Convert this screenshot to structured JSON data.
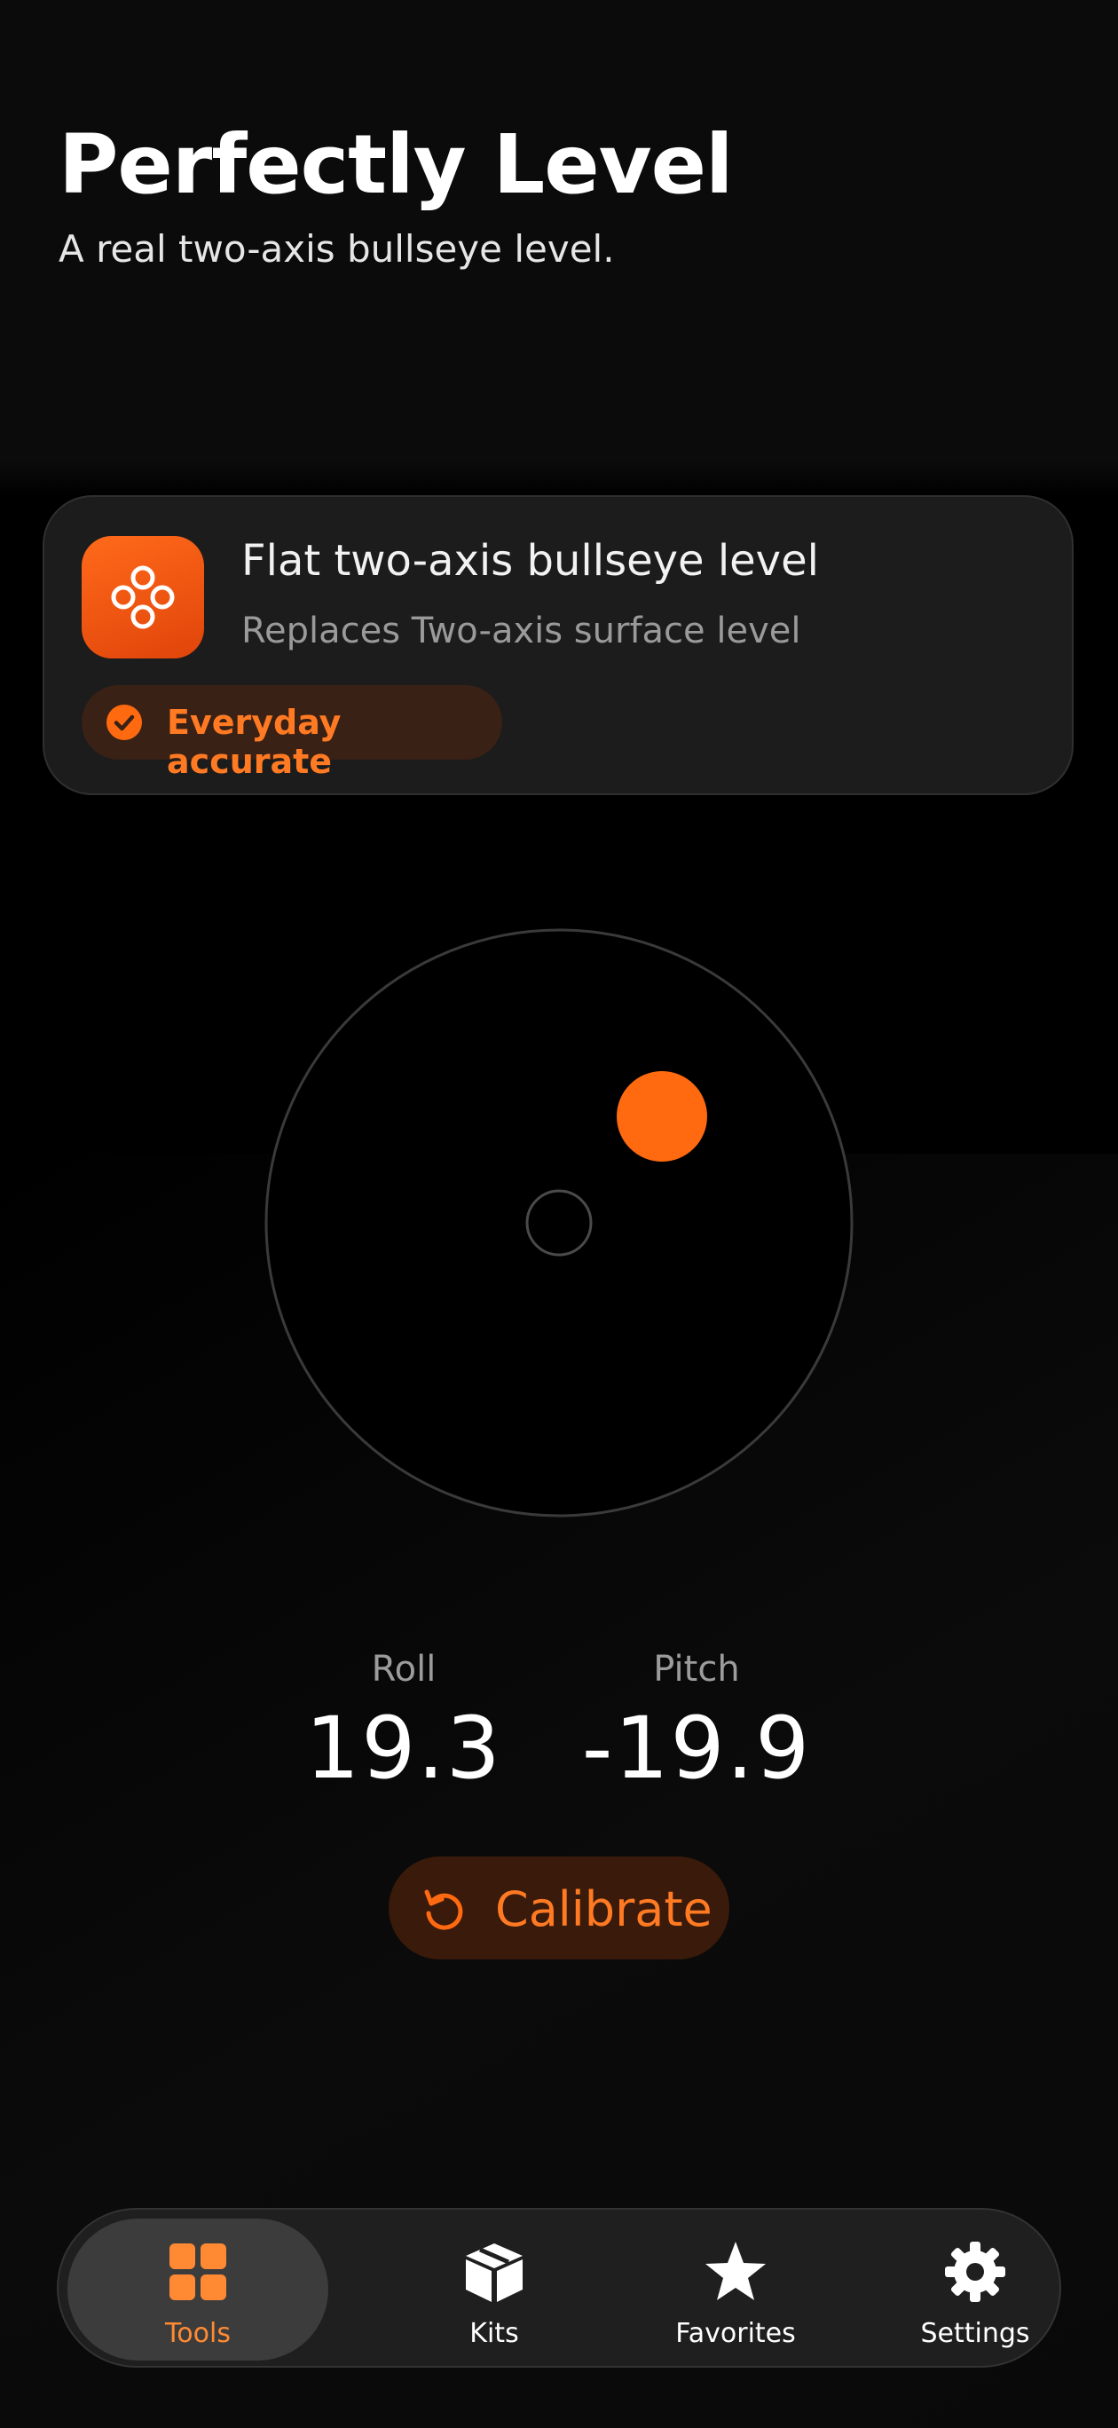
{
  "header": {
    "title": "Perfectly Level",
    "subtitle": "A real two-axis bullseye level."
  },
  "tool_card": {
    "icon": "bullseye-level-icon",
    "title": "Flat two-axis bullseye level",
    "replaces": "Replaces Two-axis surface level",
    "badge": {
      "icon": "check-circle-icon",
      "label": "Everyday accurate"
    }
  },
  "level": {
    "roll": "19.3",
    "pitch": "-19.9",
    "roll_label": "Roll",
    "pitch_label": "Pitch"
  },
  "calibrate": {
    "icon": "rotate-ccw-icon",
    "label": "Calibrate"
  },
  "tab_bar": {
    "items": [
      {
        "label": "Tools",
        "icon": "grid-icon",
        "active": true
      },
      {
        "label": "Kits",
        "icon": "box-icon",
        "active": false
      },
      {
        "label": "Favorites",
        "icon": "star-icon",
        "active": false
      },
      {
        "label": "Settings",
        "icon": "gear-icon",
        "active": false
      }
    ]
  },
  "colors": {
    "accent": "#ff6a10",
    "background": "#000000",
    "card": "#1c1c1c"
  }
}
